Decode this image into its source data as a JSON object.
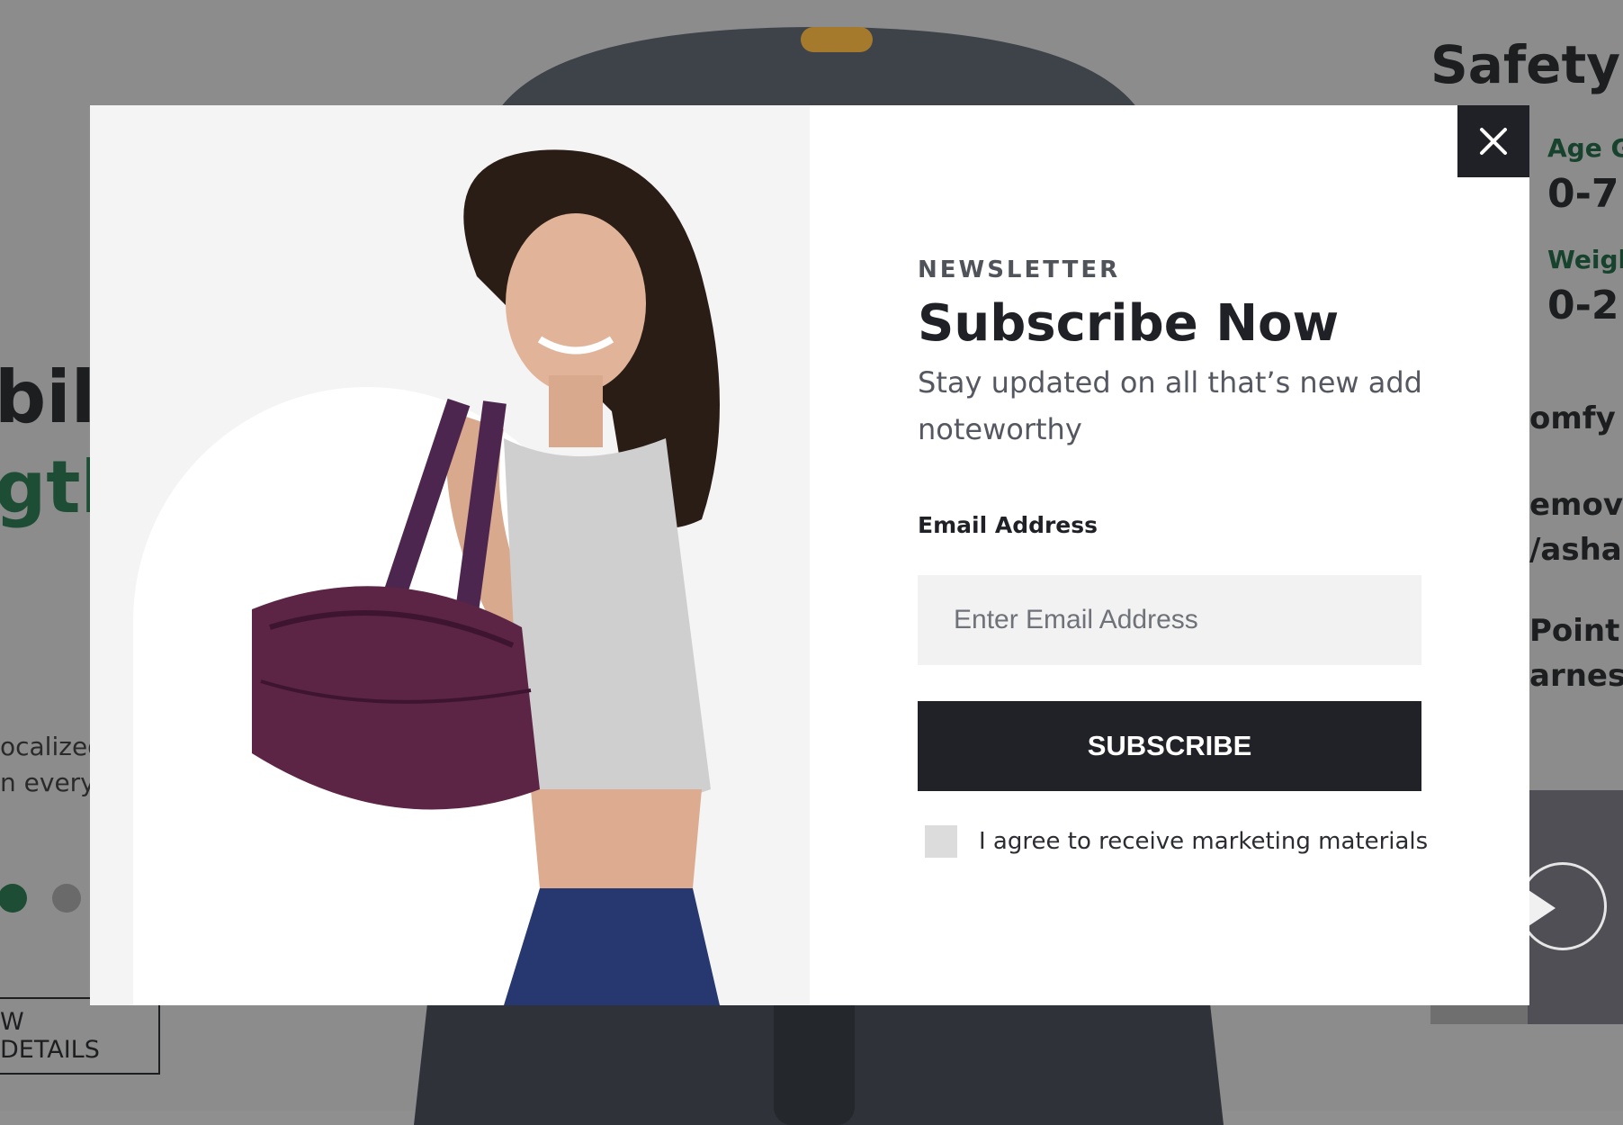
{
  "background": {
    "heading_line1": "bil",
    "heading_line2": "gth",
    "paragraph_line1": "ocalized",
    "paragraph_line2": "n every r",
    "details_button": "W DETAILS",
    "side_title": "Safety C",
    "specs": [
      {
        "label": "Age Gr",
        "value": "0-7"
      },
      {
        "label": "Weight",
        "value": "0-2"
      }
    ],
    "features": [
      "omfy I",
      "emova",
      "/ashab",
      "Point",
      "arness"
    ]
  },
  "modal": {
    "eyebrow": "NEWSLETTER",
    "title": "Subscribe Now",
    "subtitle": "Stay updated on all that’s new add noteworthy",
    "email_label": "Email Address",
    "email_placeholder": "Enter Email Address",
    "email_value": "",
    "subscribe_label": "SUBSCRIBE",
    "agree_label": "I agree to receive marketing materials",
    "agree_checked": false
  },
  "colors": {
    "overlay": "#8c8c8c",
    "button_dark": "#202227",
    "accent_green": "#17432e"
  },
  "icons": {
    "close": "close-icon",
    "play": "play-icon"
  }
}
